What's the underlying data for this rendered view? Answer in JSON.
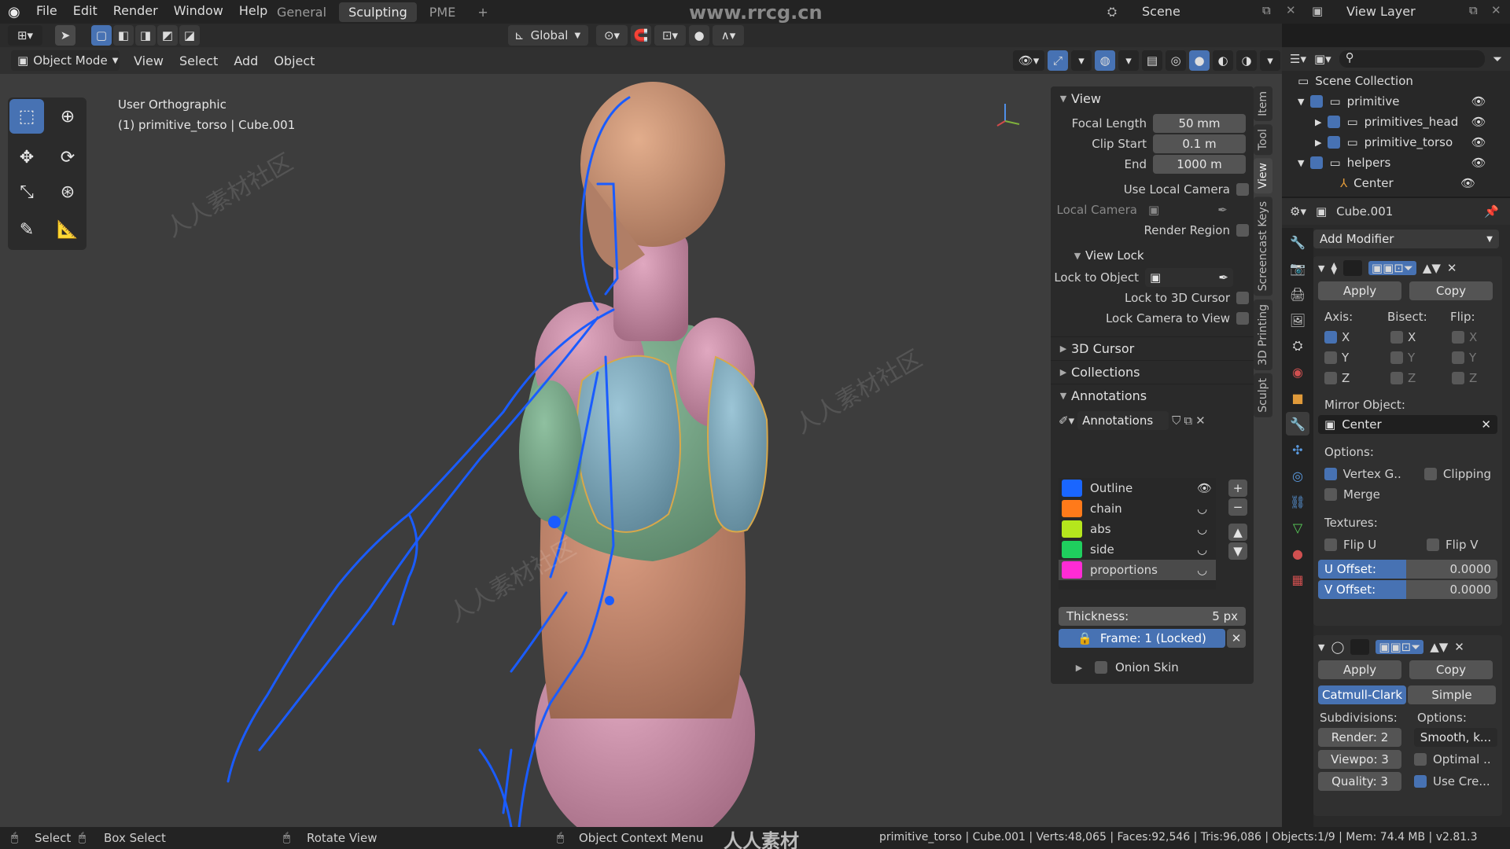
{
  "menubar": {
    "items": [
      "File",
      "Edit",
      "Render",
      "Window",
      "Help"
    ],
    "workspaces": [
      "General",
      "Sculpting",
      "PME"
    ],
    "active_workspace": "Sculpting",
    "watermark": "www.rrcg.cn",
    "scene_label": "Scene",
    "view_layer_label": "View Layer"
  },
  "header": {
    "orientation": "Global"
  },
  "header2": {
    "mode": "Object Mode",
    "menus": [
      "View",
      "Select",
      "Add",
      "Object"
    ]
  },
  "viewport": {
    "view_name": "User Orthographic",
    "object_info": "(1) primitive_torso | Cube.001"
  },
  "npanel": {
    "view": {
      "title": "View",
      "focal_length_label": "Focal Length",
      "focal_length": "50 mm",
      "clip_start_label": "Clip Start",
      "clip_start": "0.1 m",
      "clip_end_label": "End",
      "clip_end": "1000 m",
      "use_local_camera": "Use Local Camera",
      "local_camera": "Local Camera",
      "render_region": "Render Region"
    },
    "view_lock": {
      "title": "View Lock",
      "lock_to_object": "Lock to Object",
      "lock_to_cursor": "Lock to 3D Cursor",
      "lock_camera": "Lock Camera to View"
    },
    "sections": [
      "3D Cursor",
      "Collections",
      "Annotations"
    ],
    "annotations": {
      "layer_name": "Annotations",
      "layers": [
        {
          "name": "Outline",
          "color": "#1a66ff"
        },
        {
          "name": "chain",
          "color": "#ff7a1a"
        },
        {
          "name": "abs",
          "color": "#b5e61d"
        },
        {
          "name": "side",
          "color": "#1fcf5e"
        },
        {
          "name": "proportions",
          "color": "#ff2bd5"
        }
      ],
      "thickness_label": "Thickness:",
      "thickness": "5 px",
      "frame": "Frame: 1 (Locked)",
      "onion_skin": "Onion Skin"
    },
    "tabs": [
      "Item",
      "Tool",
      "View",
      "Screencast Keys",
      "3D Printing",
      "Sculpt"
    ],
    "active_tab": "View"
  },
  "outliner": {
    "title": "Scene Collection",
    "items": [
      {
        "label": "primitive",
        "indent": 1
      },
      {
        "label": "primitives_head",
        "indent": 2
      },
      {
        "label": "primitive_torso",
        "indent": 2
      },
      {
        "label": "helpers",
        "indent": 1
      },
      {
        "label": "Center",
        "indent": 2
      }
    ]
  },
  "properties": {
    "object_name": "Cube.001",
    "add_modifier": "Add Modifier",
    "mirror": {
      "apply": "Apply",
      "copy": "Copy",
      "axis_label": "Axis:",
      "bisect_label": "Bisect:",
      "flip_label": "Flip:",
      "axes": [
        "X",
        "Y",
        "Z"
      ],
      "mirror_object_label": "Mirror Object:",
      "mirror_object": "Center",
      "options_label": "Options:",
      "vertex_groups": "Vertex G..",
      "clipping": "Clipping",
      "merge": "Merge",
      "textures_label": "Textures:",
      "flip_u": "Flip U",
      "flip_v": "Flip V",
      "u_offset_label": "U Offset:",
      "u_offset": "0.0000",
      "v_offset_label": "V Offset:",
      "v_offset": "0.0000"
    },
    "subsurf": {
      "apply": "Apply",
      "copy": "Copy",
      "catmull": "Catmull-Clark",
      "simple": "Simple",
      "subdivisions_label": "Subdivisions:",
      "options_label": "Options:",
      "render": "Render: 2",
      "viewport": "Viewpo: 3",
      "quality": "Quality: 3",
      "smooth": "Smooth, k...",
      "optimal": "Optimal ..",
      "use_creases": "Use Cre..."
    }
  },
  "statusbar": {
    "select": "Select",
    "box_select": "Box Select",
    "rotate_view": "Rotate View",
    "context_menu": "Object Context Menu",
    "watermark": "人人素材",
    "stats": "primitive_torso | Cube.001 | Verts:48,065 | Faces:92,546 | Tris:96,086 | Objects:1/9 | Mem: 74.4 MB | v2.81.3"
  }
}
